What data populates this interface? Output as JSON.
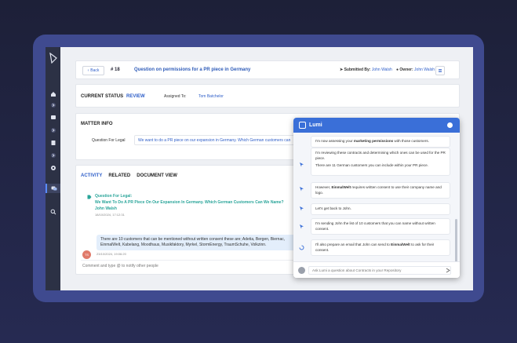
{
  "header": {
    "back_label": "Back",
    "number": "# 18",
    "title": "Question on permissions for a PR piece in Germany",
    "submitted_by_label": "Submitted By:",
    "submitted_by_value": "John Walsh",
    "owner_label": "Owner:",
    "owner_value": "John Walsh"
  },
  "status": {
    "label": "CURRENT STATUS",
    "value": "REVIEW",
    "assigned_label": "Assigned To:",
    "assigned_value": "Tom Batchelor"
  },
  "matter": {
    "title": "MATTER INFO",
    "question_label": "Question For Legal",
    "question_value": "We want to do a PR piece on our expansion in Germany. Which German customers can"
  },
  "activity": {
    "tabs": [
      "ACTIVITY",
      "RELATED",
      "DOCUMENT VIEW"
    ],
    "entry_line1": "Question For Legal:",
    "entry_line2": "We Want To Do A PR Piece On Our Expansion In Germany. Which German Customers Can We Name?",
    "entry_line3": "John Walsh",
    "entry_date": "18/10/2024, 17:12:31",
    "reply_text": "There are 10 customers that can be mentioned without written consent these are; Adetia, Bergen, Biernac, EinmalWelt, Kabelang, Moodhaus, Musikfaktory, Myrkel, StormEnergy, TraumSchuhe, Volkzinn.",
    "avatar_initials": "TS",
    "reply_date": "23/10/2024, 19:06:20",
    "comment_placeholder": "Comment and type @ to notify other people"
  },
  "lumi": {
    "title": "Lumi",
    "messages": [
      {
        "pre": "I'm now assessing your ",
        "bold": "marketing permissions",
        "post": " with those customers."
      },
      {
        "text": "I'm reviewing these contracts and determining which ones can be used for the PR piece."
      },
      {
        "text": "There are 11 German customers you can include within your PR piece."
      },
      {
        "pre": "However, ",
        "bold": "EinmalWelt",
        "post": " requires written consent to use their company name and logo."
      },
      {
        "text": "Let's get back to John."
      },
      {
        "text": "I'm sending John the list of 10 customers that you can name without written consent."
      },
      {
        "pre": "I'll also prepare an email that John can send to ",
        "bold": "EinmalWelt",
        "post": " to ask for their consent."
      }
    ],
    "input_placeholder": "Ask Lumi a question about Contracts in your Repository"
  },
  "colors": {
    "accent": "#2f5fc9",
    "teal": "#2aa59a",
    "lumi_header": "#3a6fd8",
    "frame": "#3f4a8f"
  }
}
